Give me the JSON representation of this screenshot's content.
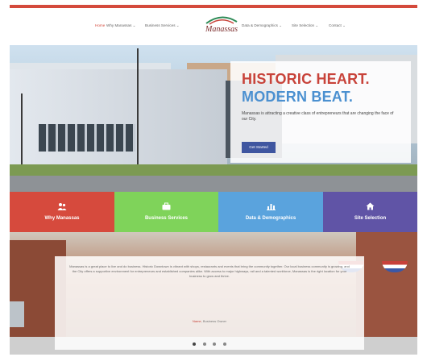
{
  "nav": {
    "items": [
      {
        "label": "Home",
        "active": true
      },
      {
        "label": "Why Manassas ⌄"
      },
      {
        "label": "Business Services ⌄"
      },
      {
        "label": "Data & Demographics ⌄"
      },
      {
        "label": "Site Selection ⌄"
      },
      {
        "label": "Contact ⌄"
      }
    ],
    "logo_text": "Manassas"
  },
  "hero": {
    "title_line1": "HISTORIC HEART.",
    "title_line2": "MODERN BEAT.",
    "body": "Manassas is attracting a creative class of entrepreneurs that are changing the face of our City.",
    "button_label": "Get Started"
  },
  "tiles": [
    {
      "label": "Why Manassas",
      "icon": "people-icon",
      "color": "#d64a3d"
    },
    {
      "label": "Business Services",
      "icon": "briefcase-icon",
      "color": "#7fd35a"
    },
    {
      "label": "Data & Demographics",
      "icon": "bar-chart-icon",
      "color": "#5aa3dd"
    },
    {
      "label": "Site Selection",
      "icon": "home-icon",
      "color": "#6054a6"
    }
  ],
  "testimonial": {
    "text": "Manassas is a great place to live and do business. Historic Downtown is vibrant with shops, restaurants and events that bring the community together. Our local business community is growing, and the City offers a supportive environment for entrepreneurs and established companies alike. With access to major highways, rail and a talented workforce, Manassas is the right location for your business to grow and thrive.",
    "author_name": "Name",
    "author_title": ", Business Owner",
    "dots": 4,
    "active_dot": 1
  },
  "colors": {
    "accent_red": "#d44a3c",
    "accent_blue": "#4b90d0",
    "button_blue": "#3f56a0"
  }
}
